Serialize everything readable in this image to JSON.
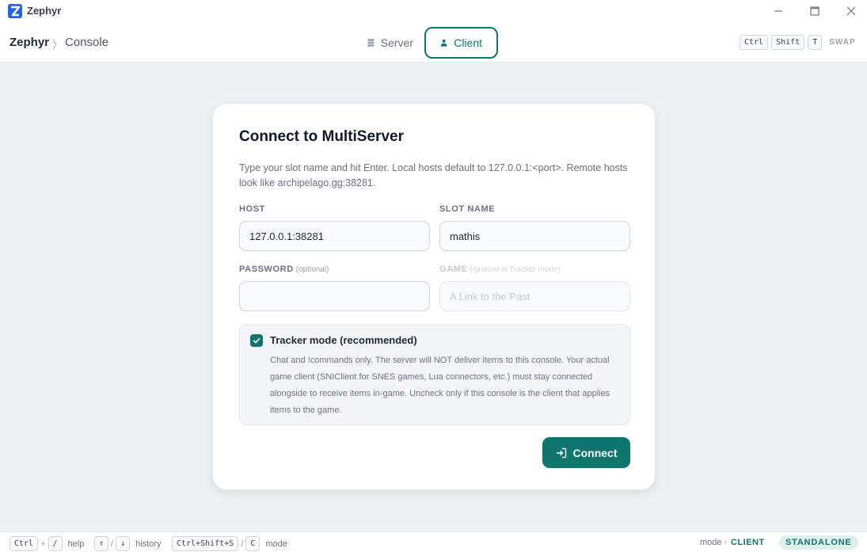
{
  "window": {
    "app_name": "Zephyr",
    "logo_icon": "zephyr-z-logo",
    "accent_color": "#0f766e"
  },
  "header": {
    "breadcrumb_root": "Zephyr",
    "breadcrumb_sep": "〉",
    "breadcrumb_page": "Console",
    "tabs": [
      {
        "label": "Server",
        "icon": "server-icon",
        "active": false
      },
      {
        "label": "Client",
        "icon": "user-icon",
        "active": true
      }
    ],
    "swap_keys": [
      "Ctrl",
      "Shift",
      "T"
    ],
    "swap_label": "SWAP"
  },
  "card": {
    "title": "Connect to MultiServer",
    "description": "Type your slot name and hit Enter. Local hosts default to 127.0.0.1:<port>. Remote hosts look like archipelago.gg:38281.",
    "host": {
      "label": "HOST",
      "value": "127.0.0.1:38281"
    },
    "slot": {
      "label": "SLOT NAME",
      "value": "mathis"
    },
    "password": {
      "label": "PASSWORD",
      "hint": "(optional)",
      "value": ""
    },
    "game": {
      "label": "GAME",
      "hint": "(ignored in Tracker mode)",
      "placeholder": "A Link to the Past",
      "disabled": true
    },
    "tracker": {
      "checked": true,
      "title": "Tracker mode (recommended)",
      "description": "Chat and !commands only. The server will NOT deliver items to this console. Your actual game client (SNIClient for SNES games, Lua connectors, etc.) must stay connected alongside to receive items in-game. Uncheck only if this console is the client that applies items to the game."
    },
    "connect_label": "Connect"
  },
  "statusbar": {
    "help": {
      "keys": [
        "Ctrl",
        "/"
      ],
      "sep": "+",
      "label": "help"
    },
    "history": {
      "keys": [
        "↑",
        "↓"
      ],
      "sep": "/",
      "label": "history"
    },
    "mode_switch": {
      "keys": [
        "Ctrl+Shift+S",
        "C"
      ],
      "sep": "/",
      "label": "mode"
    },
    "mode_prefix": "mode ·",
    "mode_value": "CLIENT",
    "badge": "STANDALONE"
  }
}
